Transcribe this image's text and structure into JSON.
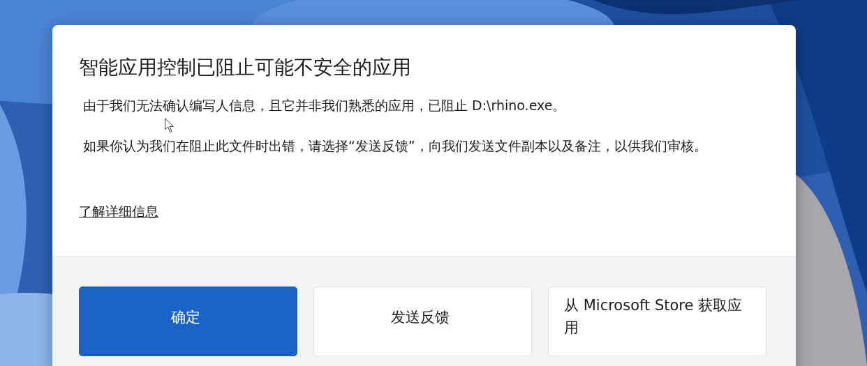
{
  "dialog": {
    "title": "智能应用控制已阻止可能不安全的应用",
    "paragraphs": [
      "由于我们无法确认编写人信息，且它并非我们熟悉的应用，已阻止 D:\\rhino.exe。",
      "如果你认为我们在阻止此文件时出错，请选择“发送反馈”，向我们发送文件副本以及备注，以供我们审核。"
    ],
    "link": "了解详细信息",
    "buttons": [
      {
        "label": "确定",
        "kind": "primary"
      },
      {
        "label": "发送反馈",
        "kind": "secondary"
      },
      {
        "label": "从 Microsoft Store 获取应用",
        "kind": "secondary"
      }
    ]
  }
}
